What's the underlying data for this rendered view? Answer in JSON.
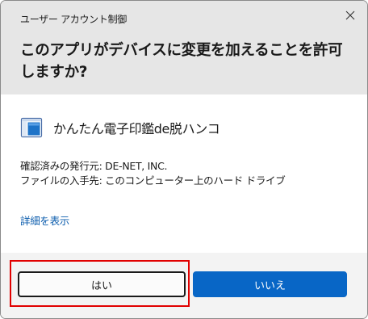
{
  "dialog": {
    "title": "ユーザー アカウント制御",
    "headline": "このアプリがデバイスに変更を加えることを許可しますか?"
  },
  "app": {
    "name": "かんたん電子印鑑de脱ハンコ",
    "icon": "app-window-icon"
  },
  "info": {
    "publisher": "確認済みの発行元: DE-NET, INC.",
    "origin": "ファイルの入手先: このコンピューター上のハード ドライブ"
  },
  "links": {
    "details": "詳細を表示"
  },
  "buttons": {
    "yes": "はい",
    "no": "いいえ"
  },
  "colors": {
    "header_bg": "#e6e6e6",
    "link": "#0b5cad",
    "primary": "#0866c6",
    "highlight": "#e10000"
  }
}
